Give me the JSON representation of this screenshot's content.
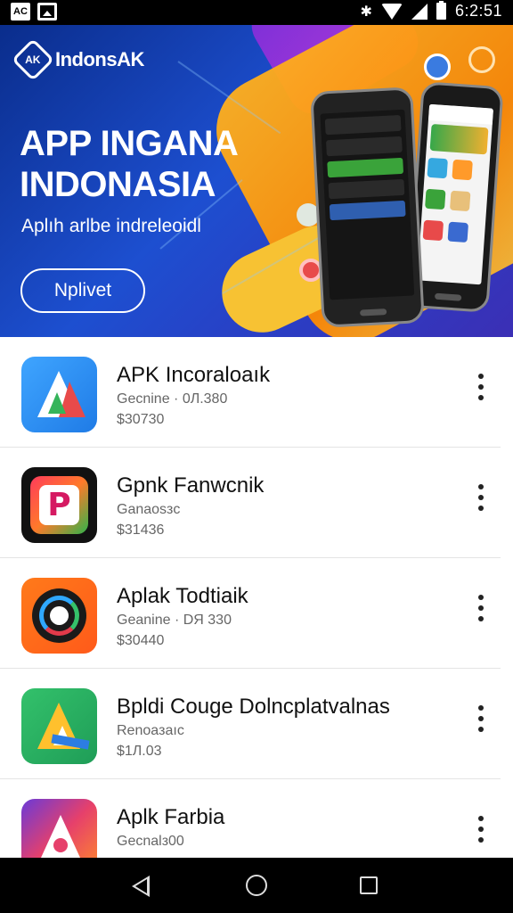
{
  "status_bar": {
    "left_icon_label": "AC",
    "time": "6:2:51"
  },
  "banner": {
    "brand_name": "IndonsAK",
    "brand_logo_text": "AK",
    "headline_line1": "APP INGANA",
    "headline_line2": "INDONASIA",
    "subline": "Aplıh arlbe indreleoidl",
    "cta_label": "Nplivet"
  },
  "apps": [
    {
      "name": "APK Incoraloaık",
      "meta": "Gecnine · 0Л.380",
      "price": "$30730",
      "icon": "blue-a-triangle-icon"
    },
    {
      "name": "Gpnk Fanwcnik",
      "meta": "Ganaosзc",
      "price": "$31436",
      "icon": "p-logo-icon"
    },
    {
      "name": "Aplak Todtiaik",
      "meta": "Geanine · DЯ 330",
      "price": "$30440",
      "icon": "ring-logo-icon"
    },
    {
      "name": "Bpldi Couge Dolncplatvalnas",
      "meta": "Renoaзaıc",
      "price": "$1Л.03",
      "icon": "green-a-triangle-icon"
    },
    {
      "name": "Aplk Farbia",
      "meta": "Gecnalз00",
      "price": "",
      "icon": "gradient-a-icon"
    }
  ],
  "colors": {
    "banner_bg": "#1d4fd0",
    "accent_orange": "#ff8a00",
    "accent_purple": "#7b2fd8"
  }
}
